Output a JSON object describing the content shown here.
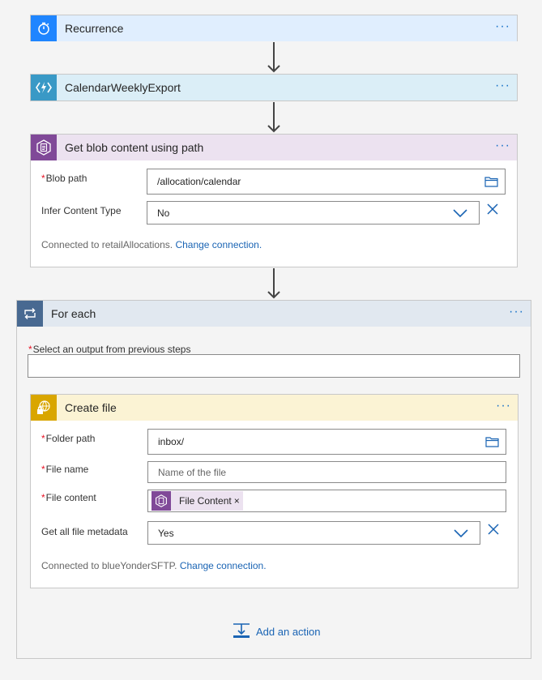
{
  "recurrence": {
    "title": "Recurrence",
    "more": "···"
  },
  "weekly_export": {
    "title": "CalendarWeeklyExport",
    "more": "···"
  },
  "get_blob": {
    "title": "Get blob content using path",
    "more": "···",
    "blob_path": {
      "required_mark": "*",
      "label": "Blob path",
      "value": "/allocation/calendar"
    },
    "infer_content_type": {
      "label": "Infer Content Type",
      "value": "No"
    },
    "connection": {
      "text": "Connected to retailAllocations.",
      "link": "Change connection."
    }
  },
  "for_each": {
    "title": "For each",
    "more": "···",
    "select_output": {
      "required_mark": "*",
      "label": "Select an output from previous steps",
      "value": ""
    },
    "create_file": {
      "title": "Create file",
      "more": "···",
      "folder_path": {
        "required_mark": "*",
        "label": "Folder path",
        "value": "inbox/"
      },
      "file_name": {
        "required_mark": "*",
        "label": "File name",
        "placeholder": "Name of the file"
      },
      "file_content": {
        "required_mark": "*",
        "label": "File content",
        "token_label": "File Content",
        "token_remove": "×"
      },
      "get_all_metadata": {
        "label": "Get all file metadata",
        "value": "Yes"
      },
      "connection": {
        "text": "Connected to blueYonderSFTP.",
        "link": "Change connection."
      }
    },
    "add_action": "Add an action"
  },
  "colors": {
    "recurrence_accent": "#1f85ff",
    "recurrence_bg": "#e0eefe",
    "function_accent": "#3999c6",
    "function_bg": "#dbeef7",
    "blob_accent": "#804998",
    "blob_bg": "#ece2f0",
    "foreach_accent": "#486991",
    "foreach_bg": "#e1e8f0",
    "sftp_accent": "#d9a600",
    "sftp_bg": "#fbf3d4",
    "link": "#1a64b4"
  },
  "icons": {
    "recurrence": "stopwatch-icon",
    "function": "lightning-icon",
    "blob": "blob-storage-icon",
    "foreach": "loop-icon",
    "sftp": "globe-lock-icon",
    "folder": "folder-icon",
    "dropdown": "chevron-down-icon",
    "clear": "close-icon",
    "add_action": "add-action-icon"
  }
}
